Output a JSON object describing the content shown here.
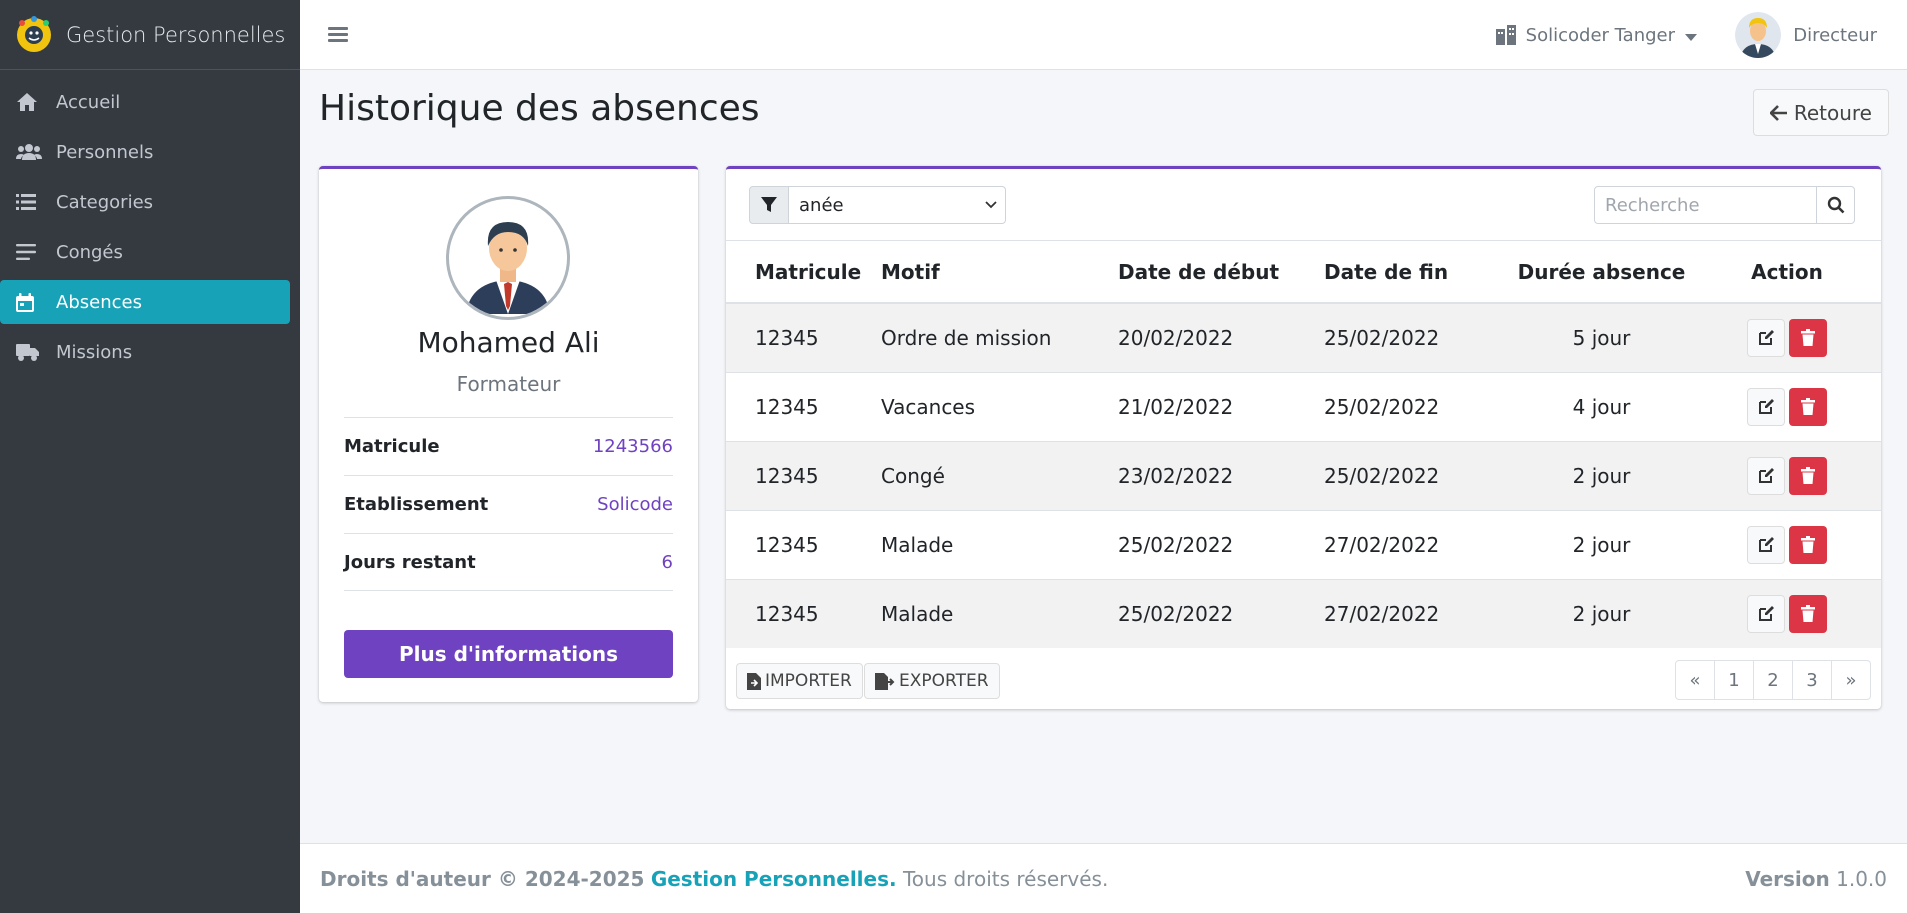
{
  "app": {
    "title": "Gestion Personnelles"
  },
  "sidebar": {
    "items": [
      {
        "label": "Accueil",
        "icon": "home-icon"
      },
      {
        "label": "Personnels",
        "icon": "users-icon"
      },
      {
        "label": "Categories",
        "icon": "list-icon"
      },
      {
        "label": "Congés",
        "icon": "lines-icon"
      },
      {
        "label": "Absences",
        "icon": "calendar-icon",
        "active": true
      },
      {
        "label": "Missions",
        "icon": "truck-icon"
      }
    ]
  },
  "header": {
    "organization": "Solicoder Tanger",
    "user_role": "Directeur"
  },
  "page": {
    "title": "Historique des absences",
    "back_label": "Retoure"
  },
  "profile": {
    "name": "Mohamed Ali",
    "role": "Formateur",
    "fields": [
      {
        "label": "Matricule",
        "value": "1243566"
      },
      {
        "label": "Etablissement",
        "value": "Solicode"
      },
      {
        "label": "Jours restant",
        "value": "6"
      }
    ],
    "more_button": "Plus d'informations"
  },
  "table": {
    "filter_value": "anée",
    "search_placeholder": "Recherche",
    "columns": [
      "Matricule",
      "Motif",
      "Date de début",
      "Date de fin",
      "Durée absence",
      "Action"
    ],
    "rows": [
      [
        "12345",
        "Ordre de mission",
        "20/02/2022",
        "25/02/2022",
        "5 jour"
      ],
      [
        "12345",
        "Vacances",
        "21/02/2022",
        "25/02/2022",
        "4 jour"
      ],
      [
        "12345",
        "Congé",
        "23/02/2022",
        "25/02/2022",
        "2 jour"
      ],
      [
        "12345",
        "Malade",
        "25/02/2022",
        "27/02/2022",
        "2 jour"
      ],
      [
        "12345",
        "Malade",
        "25/02/2022",
        "27/02/2022",
        "2 jour"
      ]
    ],
    "import_label": "IMPORTER",
    "export_label": "EXPORTER",
    "pagination": [
      "«",
      "1",
      "2",
      "3",
      "»"
    ]
  },
  "footer": {
    "copyright": "Droits d'auteur © 2024-2025",
    "brand": "Gestion Personnelles.",
    "rights": "Tous droits réservés.",
    "version_label": "Version",
    "version": "1.0.0"
  },
  "colors": {
    "sidebar_bg": "#343a40",
    "active": "#17a2b8",
    "accent": "#6f42c1",
    "danger": "#dc3545"
  }
}
